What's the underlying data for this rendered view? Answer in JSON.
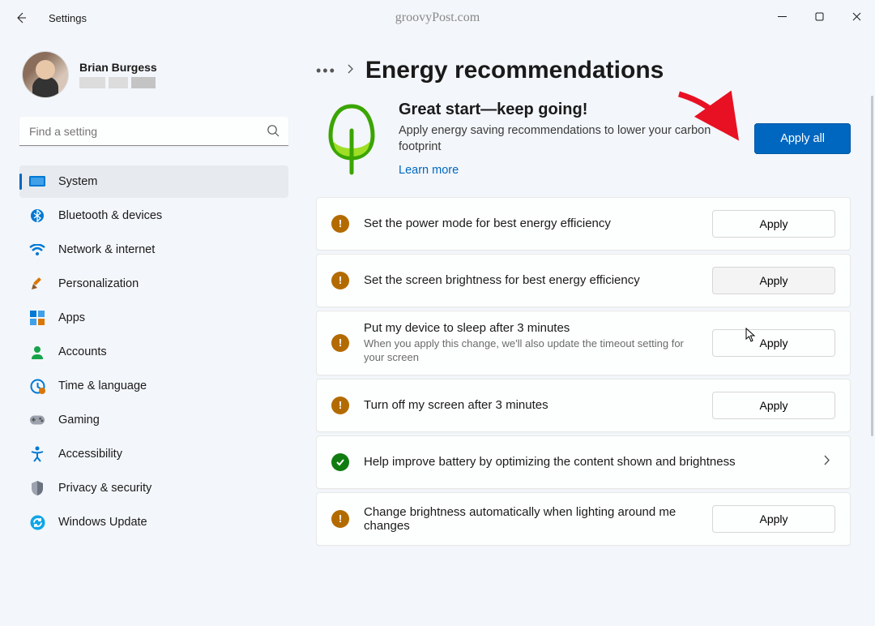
{
  "titlebar": {
    "title": "Settings",
    "watermark": "groovyPost.com"
  },
  "user": {
    "name": "Brian Burgess"
  },
  "search": {
    "placeholder": "Find a setting"
  },
  "nav": [
    {
      "id": "system",
      "label": "System",
      "active": true
    },
    {
      "id": "bluetooth",
      "label": "Bluetooth & devices"
    },
    {
      "id": "network",
      "label": "Network & internet"
    },
    {
      "id": "personalization",
      "label": "Personalization"
    },
    {
      "id": "apps",
      "label": "Apps"
    },
    {
      "id": "accounts",
      "label": "Accounts"
    },
    {
      "id": "time",
      "label": "Time & language"
    },
    {
      "id": "gaming",
      "label": "Gaming"
    },
    {
      "id": "accessibility",
      "label": "Accessibility"
    },
    {
      "id": "privacy",
      "label": "Privacy & security"
    },
    {
      "id": "update",
      "label": "Windows Update"
    }
  ],
  "page": {
    "title": "Energy recommendations",
    "hero_heading": "Great start—keep going!",
    "hero_desc": "Apply energy saving recommendations to lower your carbon footprint",
    "learn_more": "Learn more",
    "apply_all": "Apply all"
  },
  "cards": [
    {
      "status": "warn",
      "title": "Set the power mode for best energy efficiency",
      "apply": "Apply"
    },
    {
      "status": "warn",
      "title": "Set the screen brightness for best energy efficiency",
      "apply": "Apply",
      "hover": true
    },
    {
      "status": "warn",
      "title": "Put my device to sleep after 3 minutes",
      "sub": "When you apply this change, we'll also update the timeout setting for your screen",
      "apply": "Apply"
    },
    {
      "status": "warn",
      "title": "Turn off my screen after 3 minutes",
      "apply": "Apply"
    },
    {
      "status": "done",
      "title": "Help improve battery by optimizing the content shown and brightness",
      "more": true
    },
    {
      "status": "warn",
      "title": "Change brightness automatically when lighting around me changes",
      "apply": "Apply"
    }
  ]
}
